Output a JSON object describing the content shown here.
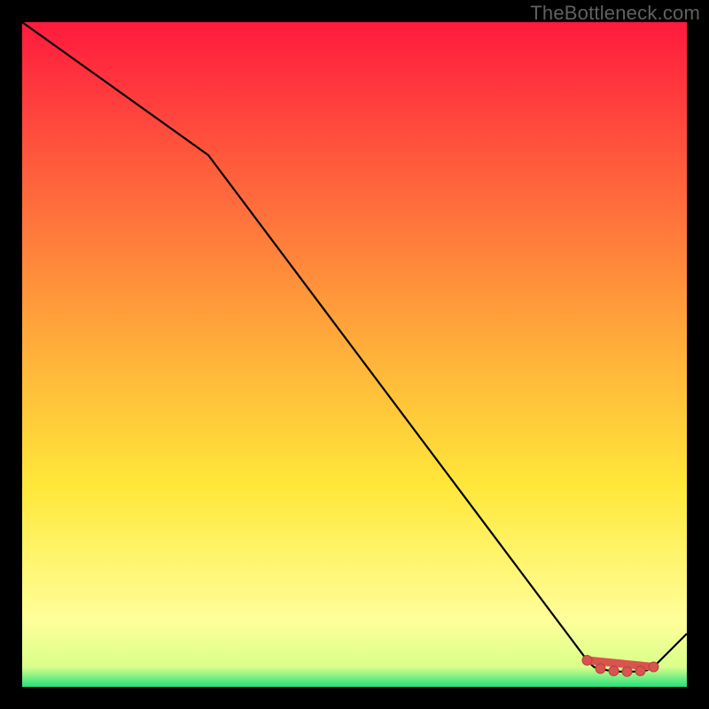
{
  "watermark": "TheBottleneck.com",
  "colors": {
    "bg": "#000000",
    "line": "#000000",
    "marker_fill": "#d9534f",
    "marker_stroke": "#b04340",
    "grad_top": "#ff1a3e",
    "grad_mid": "#ffd23a",
    "grad_low": "#ffff9a",
    "grad_bottom": "#25e07c"
  },
  "chart_data": {
    "type": "line",
    "title": "",
    "xlabel": "",
    "ylabel": "",
    "xlim": [
      0,
      100
    ],
    "ylim": [
      0,
      100
    ],
    "x": [
      0,
      28,
      85,
      86,
      88,
      90,
      92,
      94,
      95,
      100
    ],
    "values": [
      100,
      80,
      4,
      3,
      2.5,
      2.3,
      2.3,
      2.5,
      3,
      8
    ],
    "flat_segment": {
      "x_start": 85,
      "x_end": 95
    }
  }
}
